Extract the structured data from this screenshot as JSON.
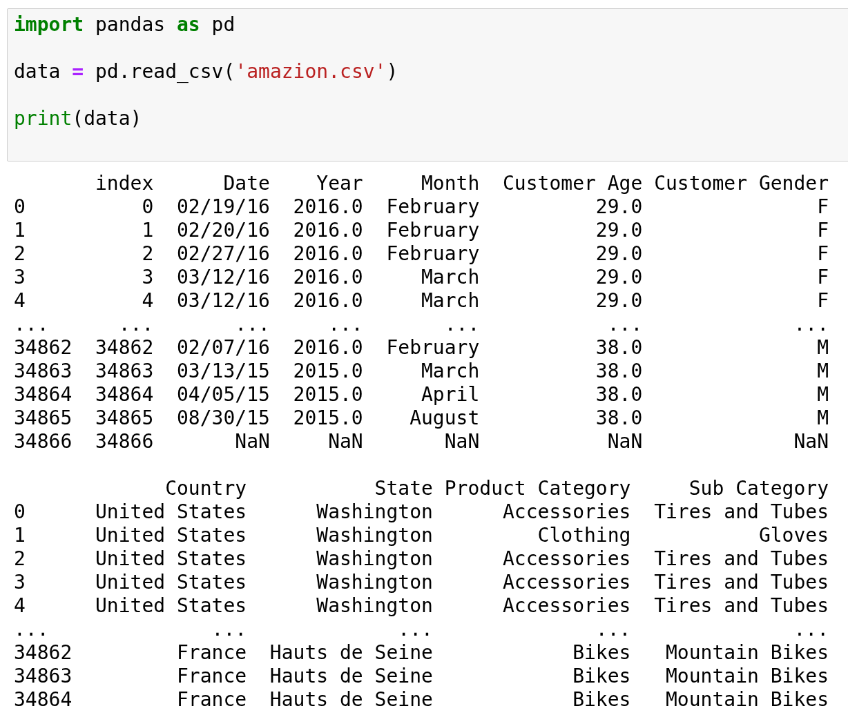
{
  "code_cell": {
    "lines": [
      [
        {
          "text": "import",
          "kind": "keyword"
        },
        {
          "text": " pandas ",
          "kind": "plain"
        },
        {
          "text": "as",
          "kind": "keyword"
        },
        {
          "text": " pd",
          "kind": "plain"
        }
      ],
      [
        {
          "text": "data ",
          "kind": "plain"
        },
        {
          "text": "=",
          "kind": "operator"
        },
        {
          "text": " pd.read_csv(",
          "kind": "plain"
        },
        {
          "text": "'amazion.csv'",
          "kind": "string"
        },
        {
          "text": ")",
          "kind": "plain"
        }
      ],
      [
        {
          "text": "print",
          "kind": "builtin"
        },
        {
          "text": "(data)",
          "kind": "plain"
        }
      ]
    ]
  },
  "output": {
    "blocks": [
      {
        "lines": [
          "       index      Date    Year     Month  Customer Age Customer Gender",
          "0          0  02/19/16  2016.0  February          29.0               F",
          "1          1  02/20/16  2016.0  February          29.0               F",
          "2          2  02/27/16  2016.0  February          29.0               F",
          "3          3  03/12/16  2016.0     March          29.0               F",
          "4          4  03/12/16  2016.0     March          29.0               F",
          "...      ...       ...     ...       ...           ...             ...",
          "34862  34862  02/07/16  2016.0  February          38.0               M",
          "34863  34863  03/13/15  2015.0     March          38.0               M",
          "34864  34864  04/05/15  2015.0     April          38.0               M",
          "34865  34865  08/30/15  2015.0    August          38.0               M",
          "34866  34866       NaN     NaN       NaN           NaN             NaN"
        ]
      },
      {
        "lines": [
          "             Country           State Product Category     Sub Category",
          "0      United States      Washington      Accessories  Tires and Tubes",
          "1      United States      Washington         Clothing           Gloves",
          "2      United States      Washington      Accessories  Tires and Tubes",
          "3      United States      Washington      Accessories  Tires and Tubes",
          "4      United States      Washington      Accessories  Tires and Tubes",
          "...              ...             ...              ...              ...",
          "34862         France  Hauts de Seine            Bikes   Mountain Bikes",
          "34863         France  Hauts de Seine            Bikes   Mountain Bikes",
          "34864         France  Hauts de Seine            Bikes   Mountain Bikes"
        ]
      }
    ]
  }
}
